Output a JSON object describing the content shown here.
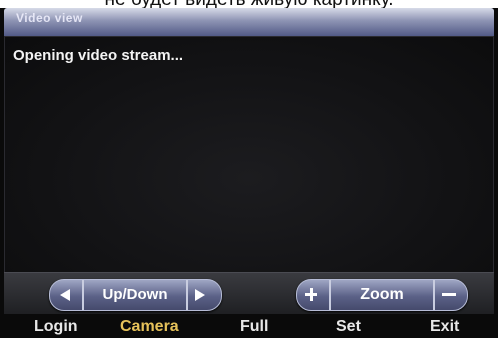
{
  "caption": "не будет видеть живую картинку.",
  "window": {
    "title": "Video view"
  },
  "video": {
    "status": "Opening video stream..."
  },
  "controls": {
    "pan": {
      "label": "Up/Down"
    },
    "zoom": {
      "label": "Zoom"
    }
  },
  "softkeys": {
    "login": "Login",
    "camera": "Camera",
    "full": "Full",
    "set": "Set",
    "exit": "Exit"
  },
  "colors": {
    "softkey_default": "#e8e8e8",
    "softkey_active": "#e6c25a",
    "pill_fill": "#5b6187",
    "titlebar": "#7e84a8"
  }
}
